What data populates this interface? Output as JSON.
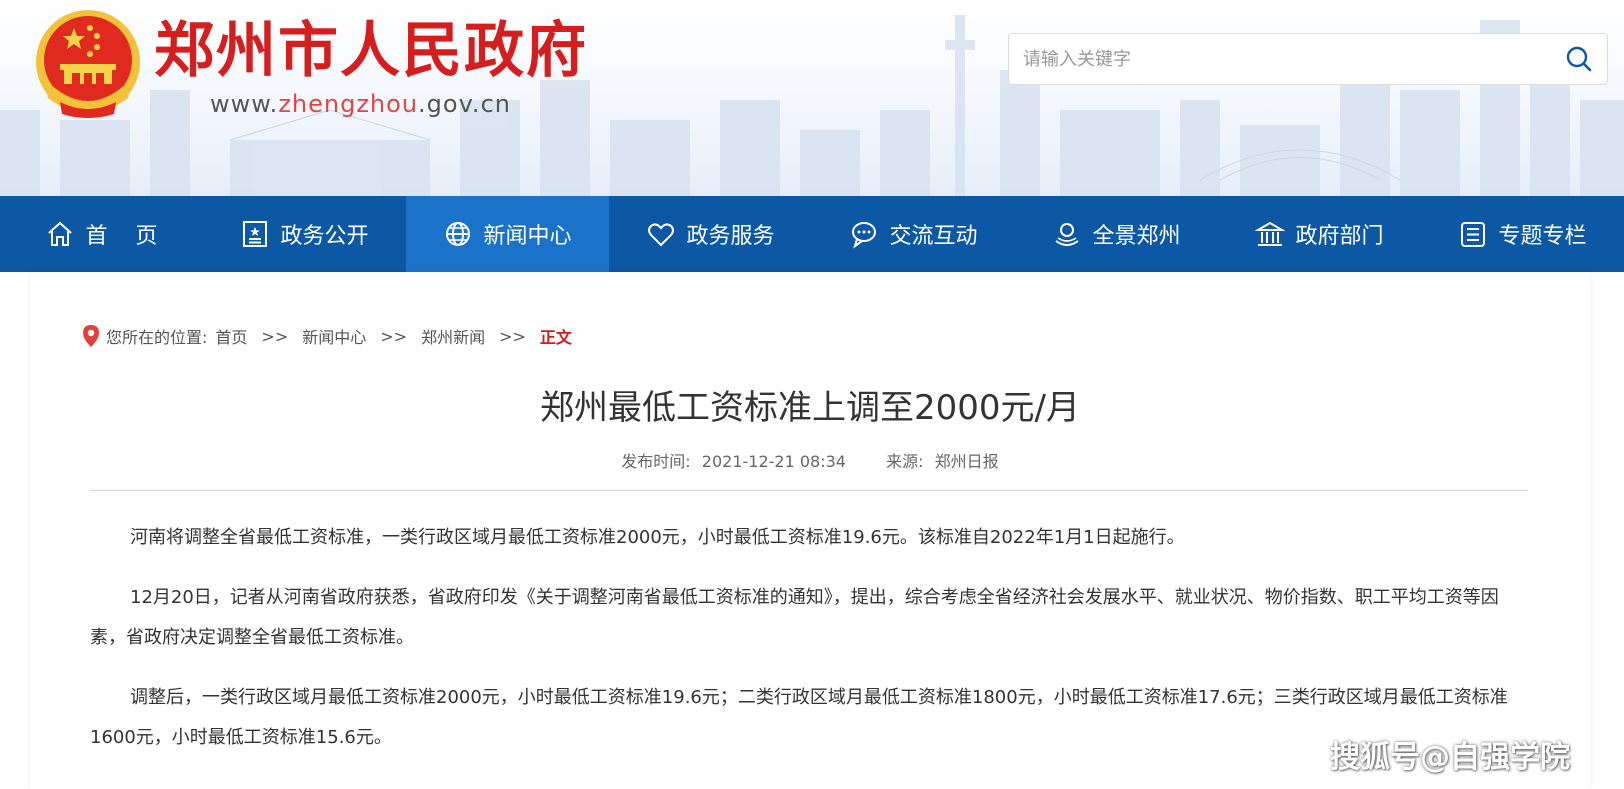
{
  "header": {
    "site_title": "郑州市人民政府",
    "url_prefix": "www.",
    "url_highlight": "zhengzhou",
    "url_suffix": ".gov.cn",
    "search_placeholder": "请输入关键字"
  },
  "nav": {
    "items": [
      {
        "label": "首页",
        "icon": "home-icon"
      },
      {
        "label": "政务公开",
        "icon": "document-icon"
      },
      {
        "label": "新闻中心",
        "icon": "globe-icon",
        "active": true
      },
      {
        "label": "政务服务",
        "icon": "heart-icon"
      },
      {
        "label": "交流互动",
        "icon": "chat-icon"
      },
      {
        "label": "全景郑州",
        "icon": "panorama-icon"
      },
      {
        "label": "政府部门",
        "icon": "building-icon"
      },
      {
        "label": "专题专栏",
        "icon": "list-icon"
      }
    ]
  },
  "breadcrumb": {
    "prefix": "您所在的位置:",
    "items": [
      "首页",
      "新闻中心",
      "郑州新闻"
    ],
    "separator": ">>",
    "current": "正文"
  },
  "article": {
    "title": "郑州最低工资标准上调至2000元/月",
    "publish_label": "发布时间:",
    "publish_time": "2021-12-21 08:34",
    "source_label": "来源:",
    "source": "郑州日报",
    "paragraphs": [
      "河南将调整全省最低工资标准，一类行政区域月最低工资标准2000元，小时最低工资标准19.6元。该标准自2022年1月1日起施行。",
      "12月20日，记者从河南省政府获悉，省政府印发《关于调整河南省最低工资标准的通知》，提出，综合考虑全省经济社会发展水平、就业状况、物价指数、职工平均工资等因素，省政府决定调整全省最低工资标准。",
      "调整后，一类行政区域月最低工资标准2000元，小时最低工资标准19.6元；二类行政区域月最低工资标准1800元，小时最低工资标准17.6元；三类行政区域月最低工资标准1600元，小时最低工资标准15.6元。"
    ]
  },
  "watermark": "搜狐号@自强学院",
  "colors": {
    "brand_red": "#d51e1e",
    "nav_blue": "#0c58a4",
    "nav_active": "#1a73c8",
    "breadcrumb_current": "#d71a1a"
  }
}
